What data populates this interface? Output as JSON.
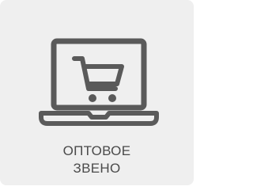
{
  "tile": {
    "icon": "laptop-cart-icon",
    "label_lines": [
      "ОПТОВОЕ",
      "ЗВЕНО"
    ]
  },
  "colors": {
    "background": "#efefef",
    "icon": "#5a5a5a",
    "text": "#4a4a4a"
  }
}
